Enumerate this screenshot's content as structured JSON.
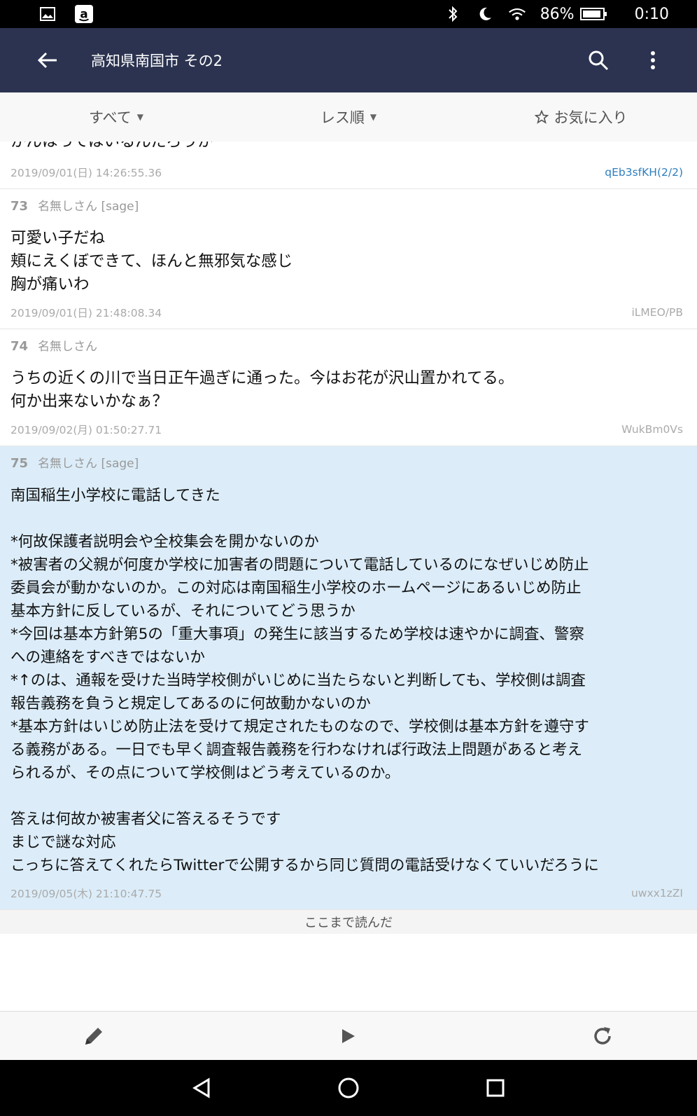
{
  "status_bar": {
    "icons": [
      "image-icon",
      "amazon-icon"
    ],
    "battery": "86%",
    "time": "0:10"
  },
  "app_bar": {
    "title": "高知県南国市 その2"
  },
  "filters": {
    "all": "すべて",
    "order": "レス順",
    "favorites": "お気に入り"
  },
  "partial_post": {
    "body": "かんはってはいるんだろうか",
    "date": "2019/09/01(日) 14:26:55.36",
    "id": "qEb3sfKH(2/2)"
  },
  "posts": [
    {
      "num": "73",
      "name": "名無しさん [sage]",
      "body": "可愛い子だね\n頬にえくぼできて、ほんと無邪気な感じ\n胸が痛いわ",
      "date": "2019/09/01(日) 21:48:08.34",
      "id": "iLMEO/PB"
    },
    {
      "num": "74",
      "name": "名無しさん",
      "body": "うちの近くの川で当日正午過ぎに通った。今はお花が沢山置かれてる。\n何か出来ないかなぁ？",
      "date": "2019/09/02(月) 01:50:27.71",
      "id": "WukBm0Vs"
    },
    {
      "num": "75",
      "name": "名無しさん [sage]",
      "body": "南国稲生小学校に電話してきた\n\n*何故保護者説明会や全校集会を開かないのか\n*被害者の父親が何度か学校に加害者の問題について電話しているのになぜいじめ防止\n委員会が動かないのか。この対応は南国稲生小学校のホームページにあるいじめ防止\n基本方針に反しているが、それについてどう思うか\n*今回は基本方針第5の「重大事項」の発生に該当するため学校は速やかに調査、警察\nへの連絡をすべきではないか\n*↑のは、通報を受けた当時学校側がいじめに当たらないと判断しても、学校側は調査\n報告義務を負うと規定してあるのに何故動かないのか\n*基本方針はいじめ防止法を受けて規定されたものなので、学校側は基本方針を遵守す\nる義務がある。一日でも早く調査報告義務を行わなければ行政法上問題があると考え\nられるが、その点について学校側はどう考えているのか。\n\n答えは何故か被害者父に答えるそうです\nまじで謎な対応\nこっちに答えてくれたらTwitterで公開するから同じ質問の電話受けなくていいだろうに",
      "date": "2019/09/05(木) 21:10:47.75",
      "id": "uwxx1zZI"
    }
  ],
  "read_marker": "ここまで読んだ",
  "bottom_bar": [
    "pencil-icon",
    "play-icon",
    "refresh-icon"
  ]
}
